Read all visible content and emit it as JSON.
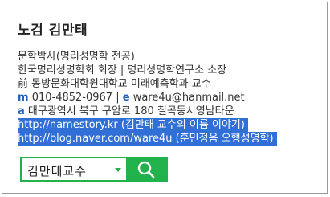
{
  "name": "노검 김만태",
  "info": {
    "title": "문학박사(명리성명학 전공)",
    "position": "한국명리성명학회 회장 | 명리성명학연구소 소장",
    "former": "前 동방문화대학원대학교 미래예측학과 교수",
    "mobile_label": "m",
    "mobile": "010-4852-0967",
    "separator": "|",
    "email_label": "e",
    "email": "ware4u@hanmail.net",
    "address_label": "a",
    "address": "대구광역시 북구 구암로 180 칠곡동서영남타운",
    "link1": "http://namestory.kr (김만태 교수의 이름 이야기)",
    "link2": "http://blog.naver.com/ware4u (훈민정음 오행성명학)"
  },
  "search": {
    "value": "김만태교수",
    "dropdown_icon": "caret-down-icon",
    "button_icon": "search-icon"
  },
  "colors": {
    "accent_green": "#22b24c",
    "label_blue": "#1f5fb8",
    "selection_blue": "#2f6fd6"
  }
}
